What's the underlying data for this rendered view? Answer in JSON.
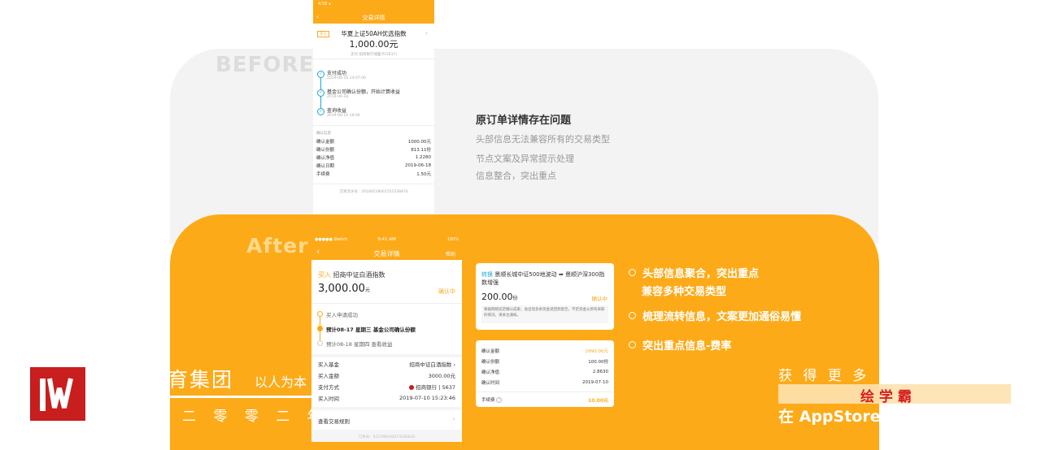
{
  "before": {
    "label": "BEFORE",
    "phone": {
      "status_time": "4:58 ◂",
      "title": "交易详情",
      "tag": "买入",
      "fund_name": "华夏上证50AH优选指数",
      "amount": "1,000.00元",
      "sub_note": "支付 招商银行储蓄卡(5637)",
      "timeline": [
        {
          "label": "支付成功",
          "time": "2019-06-16 14:07:00"
        },
        {
          "label": "基金公司确认份额，开始计算收益",
          "time": "2019-06-18"
        },
        {
          "label": "查询收益",
          "time": "2019-06-19 18:00"
        }
      ],
      "section_title": "确认信息",
      "rows": [
        {
          "k": "确认金额",
          "v": "1000.00元"
        },
        {
          "k": "确认份额",
          "v": "813.11份"
        },
        {
          "k": "确认净值",
          "v": "1.2280"
        },
        {
          "k": "确认日期",
          "v": "2019-06-18"
        },
        {
          "k": "手续费",
          "v": "1.50元"
        }
      ],
      "order_no": "交易流水号：20180518061552538876"
    },
    "heading": "原订单详情存在问题",
    "points": [
      "头部信息无法兼容所有的交易类型",
      "节点文案及异常提示处理",
      "信息整合，突出重点"
    ]
  },
  "after": {
    "label": "After",
    "phone": {
      "status_left": "●●●●● Sketch",
      "status_time": "9:41 AM",
      "status_right": "100%",
      "title": "交易详情",
      "help": "帮助",
      "buy_label": "买入",
      "fund_name": "招商中证白酒指数",
      "amount": "3,000.00",
      "amount_unit": "元",
      "status": "确认中",
      "timeline": [
        "买入申请成功",
        "预计08-17 星期三 基金公司确认份额",
        "预计08-18 星期四 查看收益"
      ],
      "rows": [
        {
          "k": "买入基金",
          "v": "招商中证白酒指数 ›"
        },
        {
          "k": "买入金额",
          "v": "3000.00元"
        },
        {
          "k": "支付方式",
          "v": "招商银行 | 5637"
        },
        {
          "k": "买入时间",
          "v": "2019-07-10 15:23:46"
        }
      ],
      "rules": "查看交易规则",
      "order_no": "订单号：611788192073546620"
    },
    "card1": {
      "tag": "转换",
      "from": "景顺长城中证500地波动",
      "arrow": "➡",
      "to": "景顺沪深300指数增强",
      "amount": "200.00",
      "unit": "份",
      "status": "确认中",
      "note": "根据网络延迟确认成果，会出现多余资金退回到盘至，不足资金从原有采取的情况，请关注通知。"
    },
    "card2": {
      "rows": [
        {
          "k": "确认金额",
          "v": "2990.00元"
        },
        {
          "k": "确认份额",
          "v": "100.00份"
        },
        {
          "k": "确认净值",
          "v": "2.8630"
        },
        {
          "k": "确认时间",
          "v": "2019-07-10"
        }
      ],
      "fee_label": "手续费",
      "fee_value": "10.00元"
    },
    "points": [
      {
        "line1": "头部信息聚合，突出重点",
        "line2": "兼容多种交易类型"
      },
      {
        "line1": "梳理流转信息，文案更加通俗易懂",
        "line2": ""
      },
      {
        "line1": "突出重点信息-费率",
        "line2": ""
      }
    ]
  },
  "watermark": {
    "left_title": "育集团",
    "left_slogan": "以人为本",
    "left_year": "二 零 零 二 年",
    "right_line1": "获 得 更 多 ",
    "right_brand": "绘 学 霸",
    "right_line3": "在 AppStore"
  },
  "colors": {
    "accent": "#fdaa18",
    "before_bg": "#f3f3f3",
    "logo_red": "#c81e1e"
  }
}
